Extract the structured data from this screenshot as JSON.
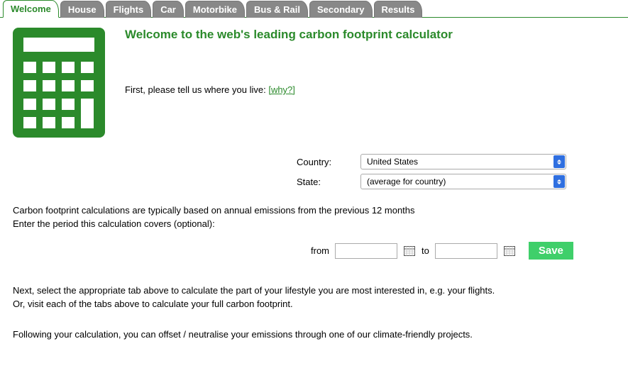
{
  "tabs": [
    {
      "label": "Welcome",
      "active": true
    },
    {
      "label": "House"
    },
    {
      "label": "Flights"
    },
    {
      "label": "Car"
    },
    {
      "label": "Motorbike"
    },
    {
      "label": "Bus & Rail"
    },
    {
      "label": "Secondary"
    },
    {
      "label": "Results"
    }
  ],
  "hero": {
    "title": "Welcome to the web's leading carbon footprint calculator",
    "intro": "First, please tell us where you live:",
    "why": "[why?]"
  },
  "location": {
    "country_label": "Country:",
    "country_value": "United States",
    "state_label": "State:",
    "state_value": "(average for country)"
  },
  "body": {
    "p1": "Carbon footprint calculations are typically based on annual emissions from the previous 12 months",
    "p2": "Enter the period this calculation covers (optional):",
    "from_label": "from",
    "to_label": "to",
    "save": "Save",
    "p3": "Next, select the appropriate tab above to calculate the part of your lifestyle you are most interested in, e.g. your flights.",
    "p4": "Or, visit each of the tabs above to calculate your full carbon footprint.",
    "p5": "Following your calculation, you can offset / neutralise your emissions through one of our climate-friendly projects."
  }
}
